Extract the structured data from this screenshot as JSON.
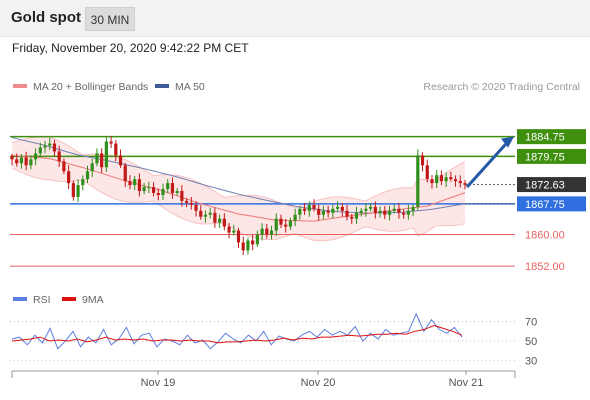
{
  "header": {
    "instrument": "Gold spot",
    "timeframe": "30 MIN"
  },
  "datetime": "Friday, November 20, 2020 9:42:22 PM CET",
  "legend": [
    {
      "label": "MA 20 + Bollinger Bands",
      "color": "#f08c8c"
    },
    {
      "label": "MA 50",
      "color": "#3d5a99"
    }
  ],
  "credit": "Research © 2020 Trading Central",
  "rsi_legend": [
    {
      "label": "RSI",
      "color": "#5b7fde"
    },
    {
      "label": "9MA",
      "color": "#dd1111"
    }
  ],
  "colors": {
    "resistance": "#3f8f0f",
    "pivot": "#2f6fe0",
    "support": "#e86060",
    "last": "#333333",
    "arrow": "#2658a8",
    "candle_up": "#2f8f1a",
    "candle_down": "#c21818"
  },
  "chart_data": [
    {
      "type": "candlestick",
      "title": "Gold spot",
      "x_ticks": [
        "Nov 19",
        "Nov 20",
        "Nov 21"
      ],
      "ylim": [
        1848,
        1893
      ],
      "levels": [
        {
          "value": 1884.75,
          "label": "1884.75",
          "kind": "resistance"
        },
        {
          "value": 1879.75,
          "label": "1879.75",
          "kind": "resistance"
        },
        {
          "value": 1872.63,
          "label": "1872.63",
          "kind": "last"
        },
        {
          "value": 1867.75,
          "label": "1867.75",
          "kind": "pivot"
        },
        {
          "value": 1860.0,
          "label": "1860.00",
          "kind": "support"
        },
        {
          "value": 1852.0,
          "label": "1852.00",
          "kind": "support"
        }
      ],
      "projection": {
        "from": 1872.0,
        "to": 1884.75
      },
      "series": [
        {
          "name": "Price",
          "values": [
            1879,
            1878,
            1879.5,
            1877.5,
            1879,
            1880.5,
            1882,
            1882.5,
            1883,
            1881,
            1878.5,
            1876,
            1873,
            1869.5,
            1872.5,
            1874,
            1876,
            1878,
            1880.5,
            1877,
            1883.5,
            1883,
            1880,
            1877.5,
            1873.5,
            1872.5,
            1874,
            1871,
            1872,
            1872,
            1870.5,
            1870,
            1871.5,
            1873,
            1870.5,
            1871,
            1868.5,
            1868,
            1867.5,
            1866,
            1864.5,
            1865,
            1865.5,
            1863,
            1864,
            1862,
            1860.5,
            1861,
            1858,
            1856,
            1858.5,
            1857.5,
            1860,
            1861.5,
            1860,
            1861,
            1864,
            1862.5,
            1862,
            1863.5,
            1865,
            1866.5,
            1866,
            1867.5,
            1866.5,
            1865,
            1866,
            1865.5,
            1866.5,
            1867,
            1866,
            1864.5,
            1864,
            1865.5,
            1866,
            1866.5,
            1867,
            1865.5,
            1866,
            1865,
            1866,
            1866.5,
            1865.5,
            1865,
            1866,
            1867,
            1880,
            1877.5,
            1874,
            1873,
            1875,
            1873.5,
            1874.5,
            1874,
            1873.5,
            1873,
            1872.6
          ]
        },
        {
          "name": "MA 20",
          "values": [
            1880,
            1879.2,
            1876.6,
            1873.6,
            1871,
            1867.8,
            1865.2,
            1863.6,
            1863.4,
            1864.8,
            1866,
            1867.2,
            1870.6
          ]
        },
        {
          "name": "MA 50",
          "values": [
            1884.5,
            1882.6,
            1880.2,
            1878.6,
            1876.8,
            1874.8,
            1872.4,
            1870.2,
            1868.4,
            1866.8,
            1865.8,
            1865.4,
            1865.6,
            1866.4,
            1867.8
          ]
        }
      ]
    },
    {
      "type": "line",
      "title": "RSI",
      "ylim": [
        22,
        80
      ],
      "yticks": [
        70,
        50,
        30
      ],
      "series": [
        {
          "name": "RSI",
          "values": [
            52,
            54,
            46,
            56,
            48,
            63,
            42,
            50,
            60,
            44,
            54,
            48,
            62,
            46,
            52,
            64,
            47,
            56,
            58,
            44,
            52,
            50,
            46,
            56,
            48,
            51,
            42,
            49,
            58,
            52,
            48,
            56,
            50,
            60,
            46,
            55,
            52,
            50,
            56,
            60,
            54,
            62,
            56,
            60,
            56,
            65,
            50,
            58,
            52,
            62,
            56,
            58,
            60,
            78,
            60,
            72,
            62,
            58,
            64,
            54
          ]
        },
        {
          "name": "9MA",
          "values": [
            50,
            51,
            52,
            54,
            50,
            51,
            50,
            52,
            49,
            51,
            54,
            51,
            52,
            51,
            52,
            50,
            51,
            51,
            50,
            51,
            50,
            50,
            48,
            49,
            49,
            50,
            51,
            50,
            51,
            53,
            51,
            53,
            52,
            54,
            54,
            55,
            56,
            55,
            56,
            57,
            57,
            58,
            57,
            60,
            62,
            66,
            63,
            60,
            56
          ]
        }
      ]
    }
  ]
}
